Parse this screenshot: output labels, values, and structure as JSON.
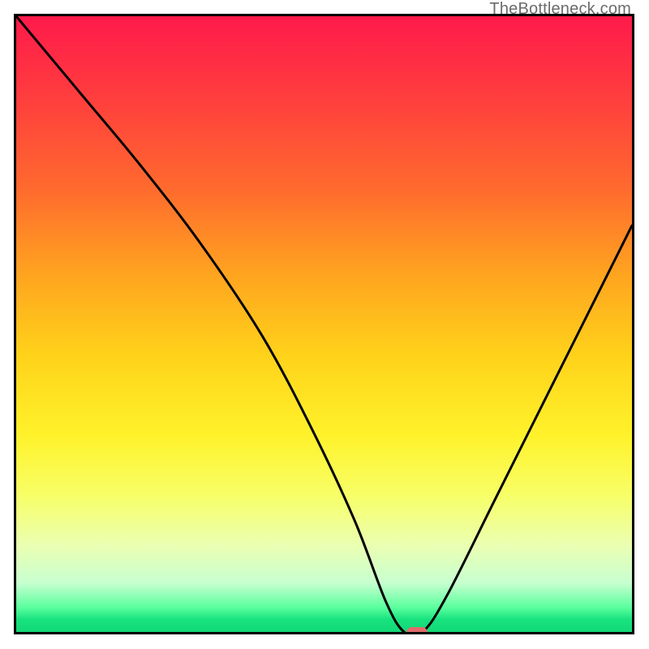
{
  "watermark": {
    "text": "TheBottleneck.com"
  },
  "chart_data": {
    "type": "line",
    "title": "",
    "xlabel": "",
    "ylabel": "",
    "xlim": [
      0,
      100
    ],
    "ylim": [
      0,
      100
    ],
    "grid": false,
    "legend": false,
    "marker": {
      "name": "bottleneck-minimum-marker",
      "x": 65,
      "y": 0,
      "color": "#e46a6a"
    },
    "series": [
      {
        "name": "bottleneck-curve",
        "x": [
          0,
          10,
          20,
          30,
          40,
          48,
          55,
          60,
          63,
          66,
          70,
          78,
          88,
          100
        ],
        "y": [
          100,
          88,
          76,
          63,
          48,
          33,
          18,
          5,
          0,
          0,
          6,
          22,
          42,
          66
        ]
      }
    ],
    "background_gradient": {
      "description": "vertical heat gradient red → orange → yellow → green",
      "stops": [
        {
          "pos": 0,
          "color": "#ff1a4b"
        },
        {
          "pos": 28,
          "color": "#ff6a2e"
        },
        {
          "pos": 55,
          "color": "#ffd21a"
        },
        {
          "pos": 78,
          "color": "#f7ff68"
        },
        {
          "pos": 96,
          "color": "#5bff9e"
        },
        {
          "pos": 100,
          "color": "#12d877"
        }
      ]
    }
  }
}
